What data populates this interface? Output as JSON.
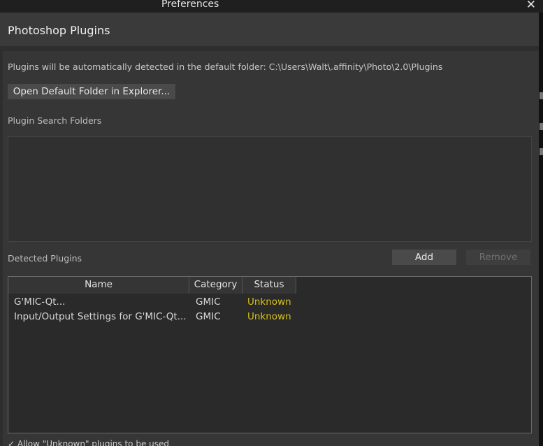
{
  "window": {
    "title": "Preferences",
    "close_glyph": "✕"
  },
  "header": {
    "title": "Photoshop Plugins"
  },
  "hint": {
    "text": "Plugins will be automatically detected in the default folder: C:\\Users\\Walt\\.affinity\\Photo\\2.0\\Plugins"
  },
  "buttons": {
    "open_default_folder": "Open Default Folder in Explorer...",
    "add": "Add",
    "remove": "Remove"
  },
  "sections": {
    "search_folders": "Plugin Search Folders",
    "detected_plugins": "Detected Plugins"
  },
  "search_folders": [],
  "table": {
    "columns": [
      "Name",
      "Category",
      "Status"
    ],
    "rows": [
      {
        "name": "G'MIC-Qt...",
        "category": "GMIC",
        "status": "Unknown"
      },
      {
        "name": "Input/Output Settings for G'MIC-Qt...",
        "category": "GMIC",
        "status": "Unknown"
      }
    ]
  },
  "footer": {
    "text": "Allow \"Unknown\" plugins to be used"
  },
  "colors": {
    "status_unknown": "#d4c21c",
    "background": "#2e2e2e"
  }
}
